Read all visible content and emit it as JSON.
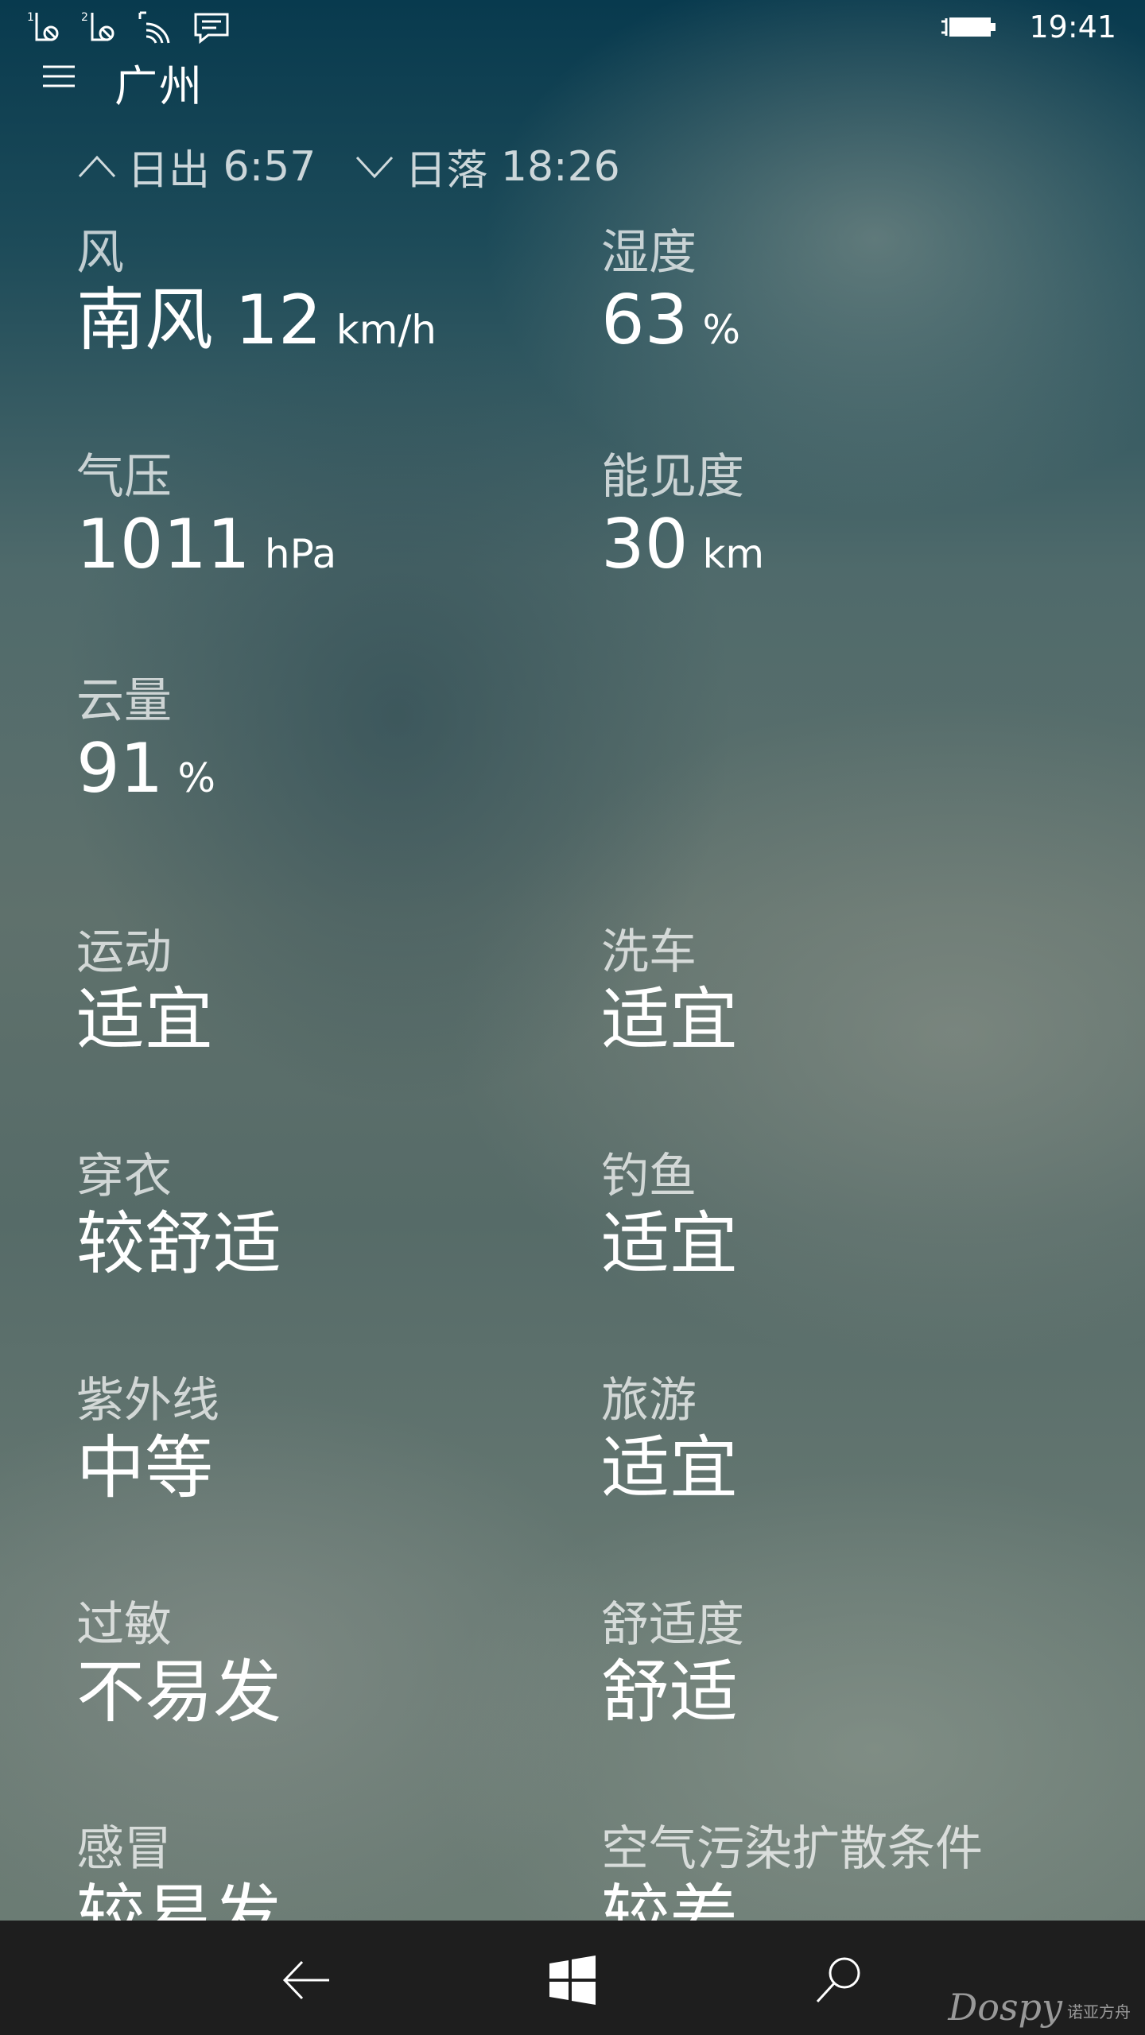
{
  "status_bar": {
    "sim1": "1",
    "sim2": "2",
    "time": "19:41"
  },
  "header": {
    "city": "广州"
  },
  "sun": {
    "sunrise_label": "日出",
    "sunrise_time": "6:57",
    "sunset_label": "日落",
    "sunset_time": "18:26"
  },
  "details": [
    {
      "label": "风",
      "value": "南风 12",
      "unit": "km/h"
    },
    {
      "label": "湿度",
      "value": "63",
      "unit": "%"
    },
    {
      "label": "气压",
      "value": "1011",
      "unit": "hPa"
    },
    {
      "label": "能见度",
      "value": "30",
      "unit": "km"
    },
    {
      "label": "云量",
      "value": "91",
      "unit": "%"
    }
  ],
  "indices": [
    {
      "label": "运动",
      "value": "适宜"
    },
    {
      "label": "洗车",
      "value": "适宜"
    },
    {
      "label": "穿衣",
      "value": "较舒适"
    },
    {
      "label": "钓鱼",
      "value": "适宜"
    },
    {
      "label": "紫外线",
      "value": "中等"
    },
    {
      "label": "旅游",
      "value": "适宜"
    },
    {
      "label": "过敏",
      "value": "不易发"
    },
    {
      "label": "舒适度",
      "value": "舒适"
    },
    {
      "label": "感冒",
      "value": "较易发"
    },
    {
      "label": "空气污染扩散条件",
      "value": "较差"
    }
  ],
  "watermark": {
    "brand": "Dospy",
    "sub": "诺亚方舟"
  }
}
